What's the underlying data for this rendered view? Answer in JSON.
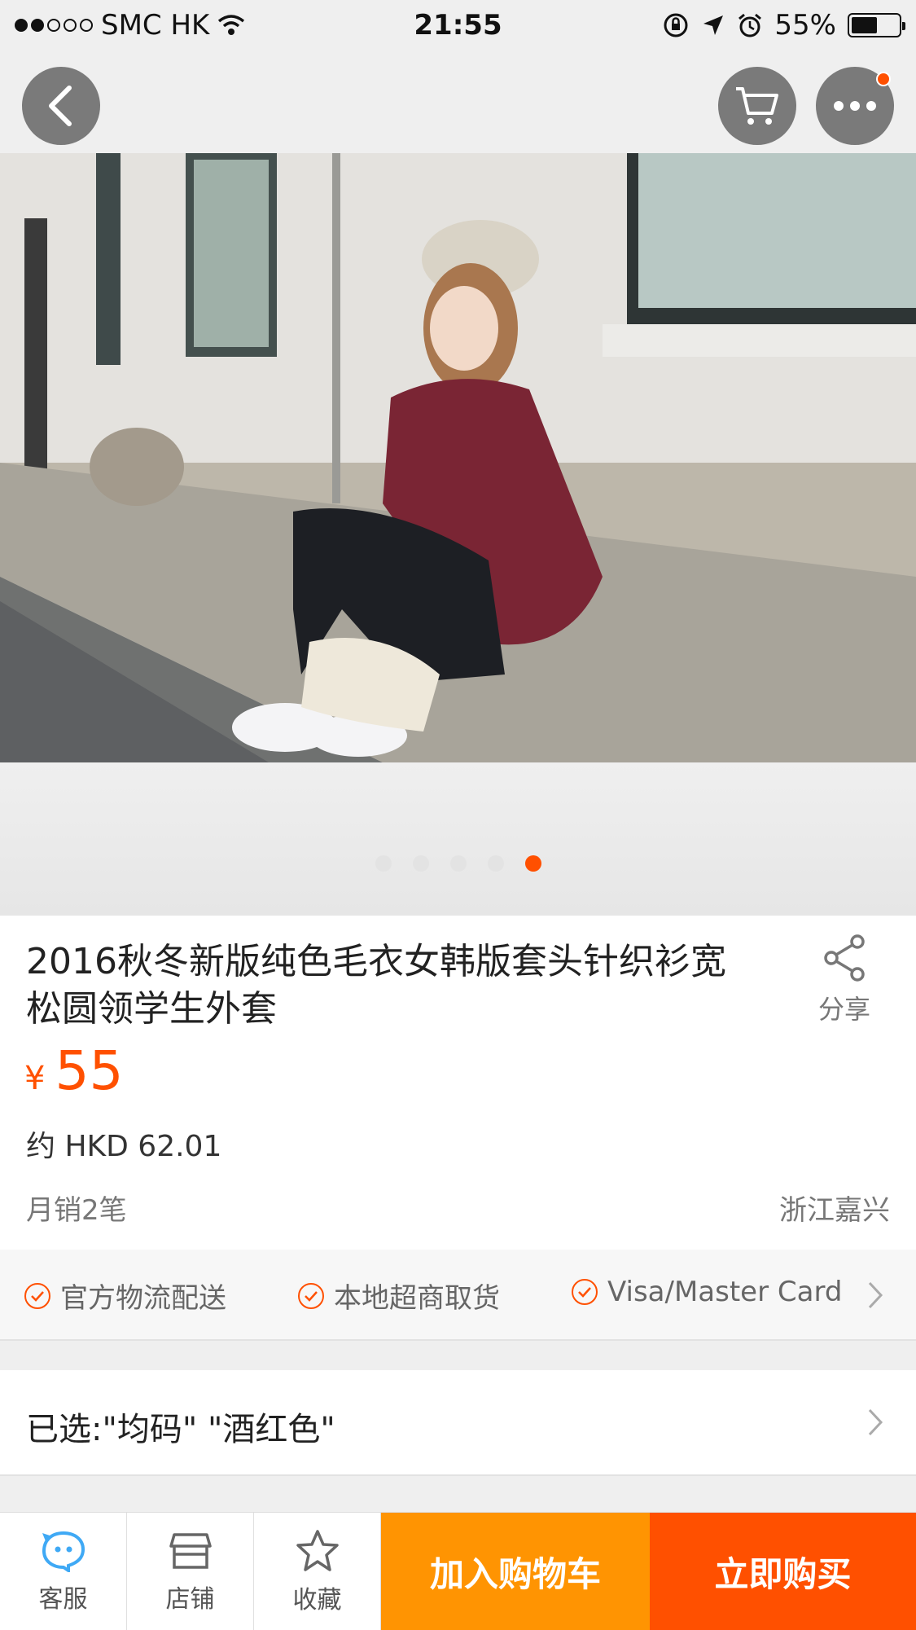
{
  "status_bar": {
    "carrier": "SMC HK",
    "time": "21:55",
    "battery": "55%",
    "battery_level": 0.55
  },
  "navbar": {
    "back_icon": "chevron-left-icon",
    "cart_icon": "cart-icon",
    "more_icon": "more-icon",
    "notification_dot_color": "#ff5000"
  },
  "gallery": {
    "total_pages": 5,
    "active_page": 5
  },
  "product": {
    "title": "2016秋冬新版纯色毛衣女韩版套头针织衫宽松圆领学生外套",
    "share_label": "分享",
    "currency_symbol": "¥",
    "price": "55",
    "approx_hkd": "约 HKD 62.01",
    "monthly_sales": "月销2笔",
    "location": "浙江嘉兴"
  },
  "services": {
    "items": [
      "官方物流配送",
      "本地超商取货",
      "Visa/Master Card"
    ]
  },
  "selection": {
    "text": "已选:\"均码\" \"酒红色\""
  },
  "bottom_bar": {
    "customer_service": "客服",
    "shop": "店铺",
    "favorite": "收藏",
    "add_to_cart": "加入购物车",
    "buy_now": "立即购买"
  },
  "colors": {
    "accent": "#ff5000",
    "cart_button": "#ff9402",
    "buy_button": "#ff5000",
    "service_blue": "#3fa9f5"
  }
}
